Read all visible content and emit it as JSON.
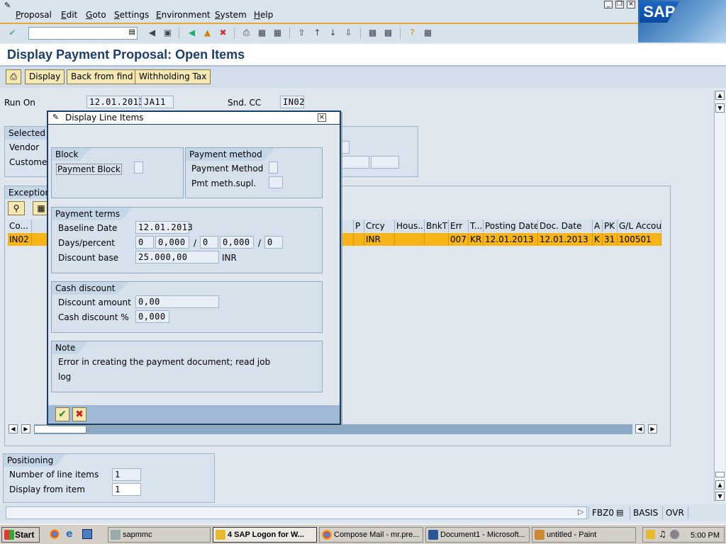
{
  "menu": {
    "items": [
      "Proposal",
      "Edit",
      "Goto",
      "Settings",
      "Environment",
      "System",
      "Help"
    ]
  },
  "logo": "SAP",
  "page_title": "Display Payment Proposal: Open Items",
  "app_toolbar": {
    "display": "Display",
    "back_from_find": "Back from find",
    "withholding_tax": "Withholding Tax"
  },
  "header": {
    "run_on_label": "Run On",
    "run_on_date": "12.01.2013",
    "run_on_id": "JA11",
    "snd_cc_label": "Snd. CC",
    "snd_cc_value": "IN02"
  },
  "selected_group": {
    "title": "Selected C",
    "vendor": "Vendor",
    "customer": "Customer"
  },
  "exceptions_group": {
    "title": "Exceptions"
  },
  "table": {
    "headers": [
      "Co...",
      "P",
      "Crcy",
      "Hous...",
      "BnkT",
      "Err",
      "T...",
      "Posting Date",
      "Doc. Date",
      "A",
      "PK",
      "G/L Accoun"
    ],
    "row": {
      "co": "IN02",
      "p": "",
      "crcy": "INR",
      "hous": "",
      "bnkt": "",
      "err": "007",
      "t": "KR",
      "posting_date": "12.01.2013",
      "doc_date": "12.01.2013",
      "a": "K",
      "pk": "31",
      "gl": "100501"
    }
  },
  "positioning": {
    "title": "Positioning",
    "num_items_label": "Number of line items",
    "num_items_value": "1",
    "display_from_label": "Display from item",
    "display_from_value": "1"
  },
  "dialog": {
    "title": "Display Line Items",
    "block": {
      "title": "Block",
      "payment_block_label": "Payment Block"
    },
    "payment_method": {
      "title": "Payment method",
      "method_label": "Payment Method",
      "supl_label": "Pmt meth.supl."
    },
    "payment_terms": {
      "title": "Payment terms",
      "baseline_label": "Baseline Date",
      "baseline_value": "12.01.2013",
      "days_label": "Days/percent",
      "days1": "0",
      "pct1": "0,000",
      "days2": "0",
      "pct2": "0,000",
      "days3": "0",
      "slash": "/",
      "discount_base_label": "Discount base",
      "discount_base_value": "25.000,00",
      "currency": "INR"
    },
    "cash_discount": {
      "title": "Cash discount",
      "amount_label": "Discount amount",
      "amount_value": "0,00",
      "pct_label": "Cash discount %",
      "pct_value": "0,000"
    },
    "note": {
      "title": "Note",
      "line1": "Error in creating the payment document; read job",
      "line2": "log"
    }
  },
  "statusbar": {
    "tcode": "FBZ0",
    "system": "BASIS",
    "mode": "OVR"
  },
  "taskbar": {
    "start": "Start",
    "tasks": [
      "sapmmc",
      "4 SAP Logon for W...",
      "Compose Mail - mr.pre...",
      "Document1 - Microsoft...",
      "untitled - Paint"
    ],
    "clock": "5:00 PM"
  }
}
